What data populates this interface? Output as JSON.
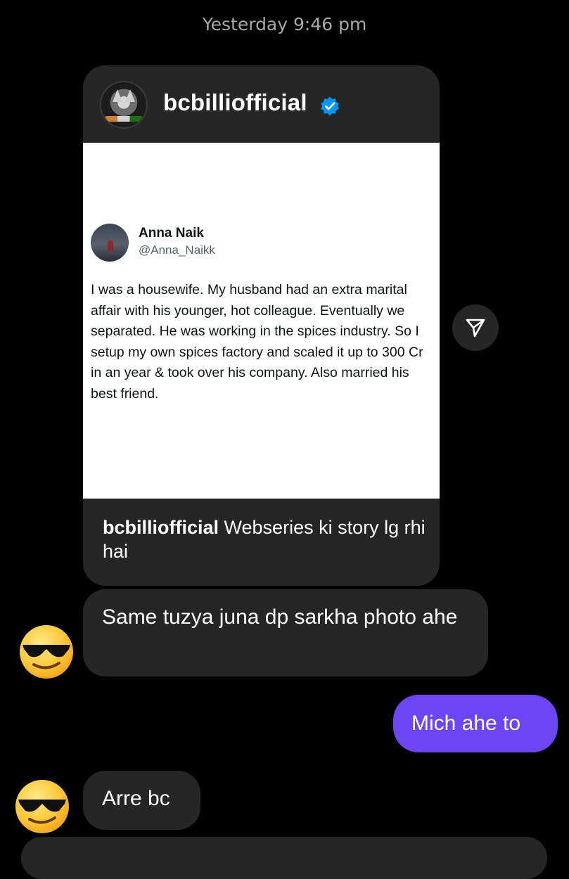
{
  "timestamp": "Yesterday 9:46 pm",
  "shared_post": {
    "username": "bcbilliofficial",
    "verified_icon": "verified-badge-icon",
    "tweet": {
      "name": "Anna Naik",
      "handle": "@Anna_Naikk",
      "text": "I was a housewife. My husband had an extra marital affair with his younger, hot colleague. Eventually we separated. He was working in the spices industry. So I setup my own spices factory and scaled it up to 300 Cr in an year & took over his company. Also married his best friend."
    },
    "caption_user": "bcbilliofficial",
    "caption_text": " Webseries ki story lg rhi hai"
  },
  "share_icon": "send-icon",
  "messages": [
    {
      "direction": "in",
      "text": "Same tuzya juna dp sarkha photo ahe",
      "avatar": "sunglasses-emoji"
    },
    {
      "direction": "out",
      "text": "Mich ahe to"
    },
    {
      "direction": "in",
      "text": "Arre bc",
      "avatar": "sunglasses-emoji"
    }
  ],
  "colors": {
    "background": "#000000",
    "incoming_bubble": "#262626",
    "outgoing_bubble": "#6b46f2",
    "verified": "#0095f6"
  }
}
